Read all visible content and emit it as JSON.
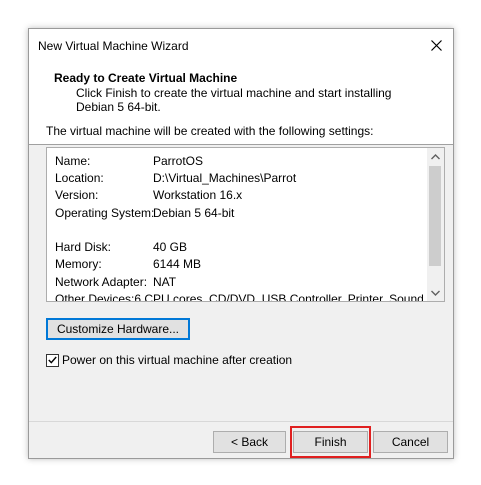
{
  "window": {
    "title": "New Virtual Machine Wizard"
  },
  "header": {
    "title": "Ready to Create Virtual Machine",
    "description": "Click Finish to create the virtual machine and start installing Debian 5 64-bit."
  },
  "intro": "The virtual machine will be created with the following settings:",
  "settings": [
    {
      "key": "Name:",
      "value": "ParrotOS"
    },
    {
      "key": "Location:",
      "value": "D:\\Virtual_Machines\\Parrot"
    },
    {
      "key": "Version:",
      "value": "Workstation 16.x"
    },
    {
      "key": "Operating System:",
      "value": "Debian 5 64-bit"
    },
    {
      "key": "",
      "value": ""
    },
    {
      "key": "Hard Disk:",
      "value": "40 GB"
    },
    {
      "key": "Memory:",
      "value": "6144 MB"
    },
    {
      "key": "Network Adapter:",
      "value": "NAT"
    },
    {
      "key": "Other Devices:",
      "value": "6 CPU cores, CD/DVD, USB Controller, Printer, Sound..."
    }
  ],
  "buttons": {
    "customize": "Customize Hardware...",
    "back": "< Back",
    "finish": "Finish",
    "cancel": "Cancel"
  },
  "power_on": {
    "label": "Power on this virtual machine after creation",
    "checked": true
  },
  "colors": {
    "highlight": "#e02020",
    "focus": "#0078d7"
  },
  "icons": {
    "close": "close-icon",
    "scroll_up": "chevron-up-icon",
    "scroll_down": "chevron-down-icon",
    "check": "checkmark-icon"
  }
}
